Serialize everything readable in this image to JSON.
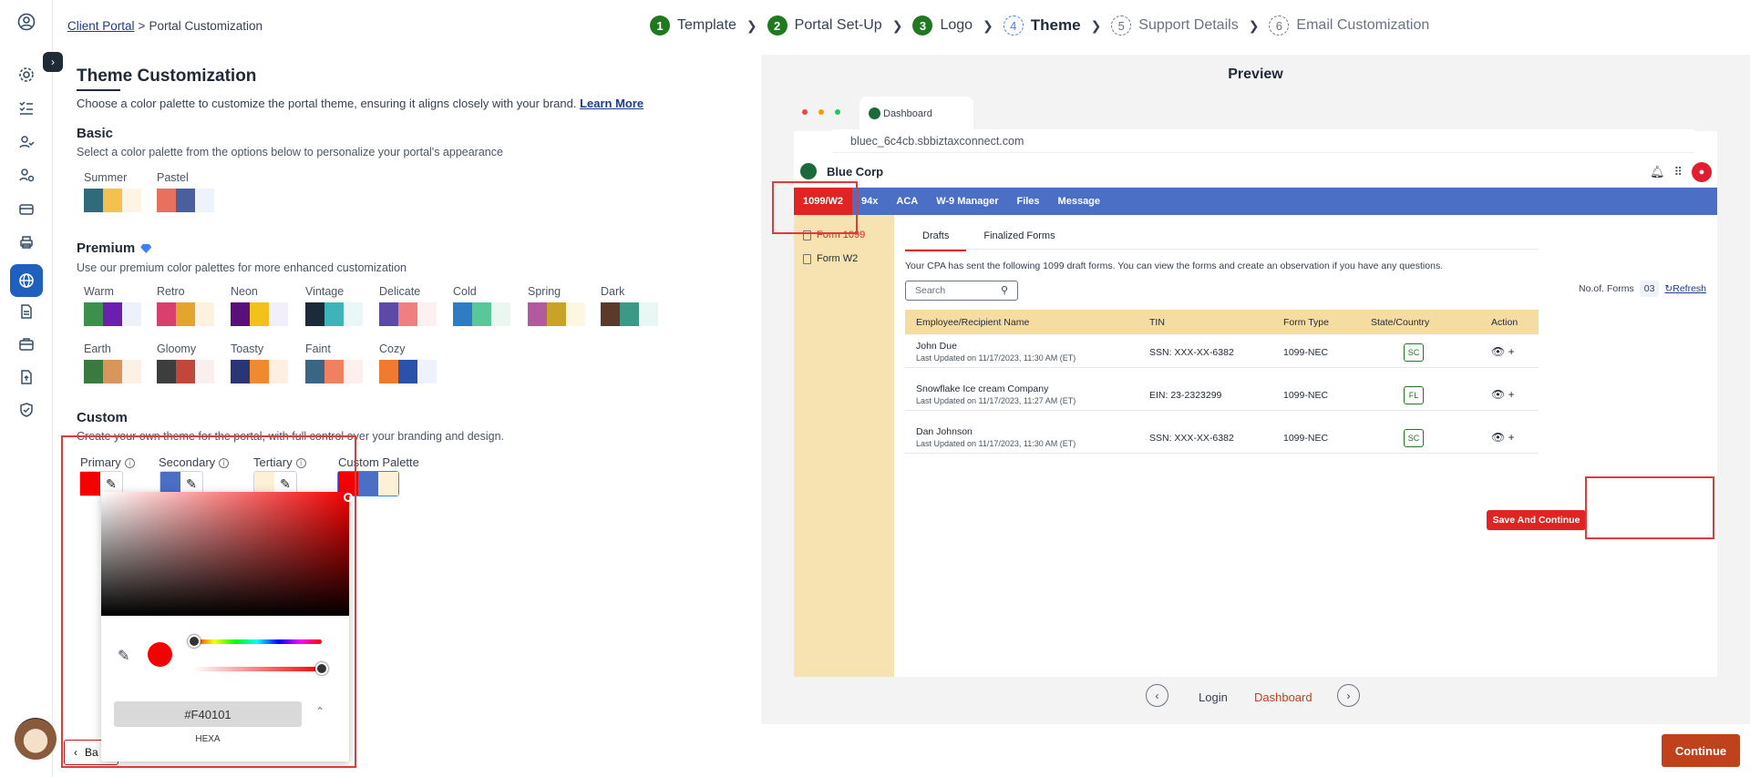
{
  "breadcrumb": {
    "link": "Client Portal",
    "sep": ">",
    "current": "Portal Customization"
  },
  "stepper": [
    {
      "num": "1",
      "label": "Template",
      "state": "done"
    },
    {
      "num": "2",
      "label": "Portal Set-Up",
      "state": "done"
    },
    {
      "num": "3",
      "label": "Logo",
      "state": "done"
    },
    {
      "num": "4",
      "label": "Theme",
      "state": "current"
    },
    {
      "num": "5",
      "label": "Support Details",
      "state": "todo"
    },
    {
      "num": "6",
      "label": "Email Customization",
      "state": "todo"
    }
  ],
  "page": {
    "title": "Theme Customization",
    "description": "Choose a color palette to customize the portal theme, ensuring it aligns closely with your brand.",
    "learn_more": "Learn More"
  },
  "basic": {
    "heading": "Basic",
    "description": "Select a color palette from the options below to personalize your portal's appearance",
    "palettes": [
      {
        "name": "Summer",
        "colors": [
          "#2f6b7c",
          "#f2c14e",
          "#fdf4e3"
        ]
      },
      {
        "name": "Pastel",
        "colors": [
          "#e8705f",
          "#4a5f9e",
          "#eef3fb"
        ]
      }
    ]
  },
  "premium": {
    "heading": "Premium",
    "description": "Use our premium color palettes for more enhanced customization",
    "palettes": [
      {
        "name": "Warm",
        "colors": [
          "#3d8f4c",
          "#6a1fb0",
          "#eef1fb"
        ]
      },
      {
        "name": "Retro",
        "colors": [
          "#d9406b",
          "#e3a52e",
          "#fdf1e0"
        ]
      },
      {
        "name": "Neon",
        "colors": [
          "#5a0f7a",
          "#f2c21b",
          "#f3eefb"
        ]
      },
      {
        "name": "Vintage",
        "colors": [
          "#1c2a3a",
          "#3eb3b8",
          "#e9f7f7"
        ]
      },
      {
        "name": "Delicate",
        "colors": [
          "#5d4aa8",
          "#f08080",
          "#fdf0f0"
        ]
      },
      {
        "name": "Cold",
        "colors": [
          "#2e7dc4",
          "#59c79a",
          "#eaf7f1"
        ]
      },
      {
        "name": "Spring",
        "colors": [
          "#b35a9e",
          "#c9a227",
          "#fcf6e3"
        ]
      },
      {
        "name": "Dark",
        "colors": [
          "#5b3a2c",
          "#3a9a86",
          "#e8f7f3"
        ]
      },
      {
        "name": "Earth",
        "colors": [
          "#3b7a3e",
          "#d9955a",
          "#fdf1e6"
        ]
      },
      {
        "name": "Gloomy",
        "colors": [
          "#3d3d3d",
          "#c0473a",
          "#fbeeee"
        ]
      },
      {
        "name": "Toasty",
        "colors": [
          "#2a3573",
          "#f08a2e",
          "#fdf0e3"
        ]
      },
      {
        "name": "Faint",
        "colors": [
          "#3a6686",
          "#ef8060",
          "#fdf0ec"
        ]
      },
      {
        "name": "Cozy",
        "colors": [
          "#ef7a30",
          "#2952a8",
          "#eef2fb"
        ]
      }
    ]
  },
  "custom": {
    "heading": "Custom",
    "description": "Create your own theme for the portal, with full control over your branding and design.",
    "primary_label": "Primary",
    "secondary_label": "Secondary",
    "tertiary_label": "Tertiary",
    "palette_label": "Custom Palette",
    "primary_color": "#f40101",
    "secondary_color": "#4a6fc4",
    "tertiary_color": "#fdf0d5",
    "info_glyph": "i",
    "pen_glyph": "✎"
  },
  "picker": {
    "hex_value": "#F40101",
    "format_label": "HEXA",
    "dropper_glyph": "✎",
    "toggle_glyph": "⌃"
  },
  "back_label": "Ba",
  "continue_label": "Continue",
  "preview": {
    "title": "Preview",
    "tab_title": "Dashboard",
    "url": "bluec_6c4cb.sbbiztaxconnect.com",
    "app_name": "Blue Corp",
    "nav": [
      "1099/W2",
      "94x",
      "ACA",
      "W-9 Manager",
      "Files",
      "Message"
    ],
    "side": [
      "Form 1099",
      "Form W2"
    ],
    "tabs": [
      "Drafts",
      "Finalized Forms"
    ],
    "message": "Your CPA has sent the following 1099 draft forms. You can view the forms and create an observation if you have any questions.",
    "search_placeholder": "Search",
    "forms_label": "No.of. Forms",
    "forms_count": "03",
    "refresh_label": "Refresh",
    "columns": [
      "Employee/Recipient Name",
      "TIN",
      "Form Type",
      "State/Country",
      "Action"
    ],
    "rows": [
      {
        "name": "John Due",
        "updated": "Last Updated on 11/17/2023, 11:30 AM (ET)",
        "tin": "SSN: XXX-XX-6382",
        "form": "1099-NEC",
        "state": "SC"
      },
      {
        "name": "Snowflake Ice cream Company",
        "updated": "Last Updated on 11/17/2023, 11:27 AM (ET)",
        "tin": "EIN: 23-2323299",
        "form": "1099-NEC",
        "state": "FL"
      },
      {
        "name": "Dan Johnson",
        "updated": "Last Updated on 11/17/2023, 11:30 AM (ET)",
        "tin": "SSN: XXX-XX-6382",
        "form": "1099-NEC",
        "state": "SC"
      }
    ],
    "save_label": "Save And Continue",
    "pager": {
      "prev": "‹",
      "left": "Login",
      "right": "Dashboard",
      "next": "›"
    }
  }
}
